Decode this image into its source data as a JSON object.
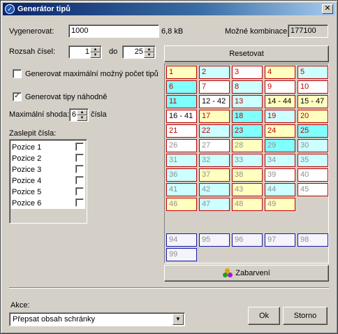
{
  "window": {
    "title": "Generátor tipů",
    "close_glyph": "✕"
  },
  "form": {
    "generate_label": "Vygenerovat:",
    "generate_value": "1000",
    "generate_size": "6,8 kB",
    "combinations_label": "Možné kombinace:",
    "combinations_value": "177100",
    "range_label": "Rozsah čísel:",
    "range_from": "1",
    "range_to_label": "do",
    "range_to": "25",
    "max_tips_label": "Generovat maximální možný počet tipů",
    "max_tips_checked": false,
    "random_label": "Generovat tipy náhodně",
    "random_checked": true,
    "max_match_label": "Maximální shoda:",
    "max_match_value": "6",
    "max_match_unit": "čísla",
    "hide_label": "Zaslepit čísla:",
    "positions": [
      {
        "label": "Pozice 1",
        "checked": false
      },
      {
        "label": "Pozice 2",
        "checked": false
      },
      {
        "label": "Pozice 3",
        "checked": false
      },
      {
        "label": "Pozice 4",
        "checked": false
      },
      {
        "label": "Pozice 5",
        "checked": false
      },
      {
        "label": "Pozice 6",
        "checked": false
      }
    ]
  },
  "grid": {
    "reset_label": "Resetovat",
    "color_label": "Zabarvení",
    "colors": {
      "white": "#ffffff",
      "yellow": "#ffffc0",
      "cyan": "#ccffff",
      "cyan_strong": "#80ffff",
      "red_border": "#c00000",
      "blue_border": "#1a1aa8"
    },
    "rows": [
      [
        {
          "t": "1",
          "c": "yellow"
        },
        {
          "t": "2",
          "c": "cyan"
        },
        {
          "t": "3",
          "c": "white"
        },
        {
          "t": "4",
          "c": "yellow"
        },
        {
          "t": "5",
          "c": "cyan"
        }
      ],
      [
        {
          "t": "6",
          "c": "cyan2"
        },
        {
          "t": "7",
          "c": "white"
        },
        {
          "t": "8",
          "c": "cyan"
        },
        {
          "t": "9",
          "c": "white"
        },
        {
          "t": "10",
          "c": "white"
        }
      ],
      [
        {
          "t": "11",
          "c": "cyan2"
        },
        {
          "t": "12 - 42",
          "c": "white"
        },
        {
          "t": "13",
          "c": "cyan"
        },
        {
          "t": "14 - 44",
          "c": "yellow"
        },
        {
          "t": "15 - 47",
          "c": "yellow"
        }
      ],
      [
        {
          "t": "16 - 41",
          "c": "white"
        },
        {
          "t": "17",
          "c": "yellow"
        },
        {
          "t": "18",
          "c": "cyan2"
        },
        {
          "t": "19",
          "c": "cyan"
        },
        {
          "t": "20",
          "c": "yellow"
        }
      ],
      [
        {
          "t": "21",
          "c": "white"
        },
        {
          "t": "22",
          "c": "cyan"
        },
        {
          "t": "23",
          "c": "cyan2"
        },
        {
          "t": "24",
          "c": "yellow"
        },
        {
          "t": "25",
          "c": "cyan2"
        }
      ],
      [
        {
          "t": "26",
          "c": "white"
        },
        {
          "t": "27",
          "c": "white"
        },
        {
          "t": "28",
          "c": "yellow"
        },
        {
          "t": "29",
          "c": "cyan2"
        },
        {
          "t": "30",
          "c": "cyan"
        }
      ],
      [
        {
          "t": "31",
          "c": "cyan"
        },
        {
          "t": "32",
          "c": "cyan"
        },
        {
          "t": "33",
          "c": "cyan"
        },
        {
          "t": "34",
          "c": "cyan"
        },
        {
          "t": "35",
          "c": "cyan"
        }
      ],
      [
        {
          "t": "36",
          "c": "cyan"
        },
        {
          "t": "37",
          "c": "yellow"
        },
        {
          "t": "38",
          "c": "yellow"
        },
        {
          "t": "39",
          "c": "white"
        },
        {
          "t": "40",
          "c": "white"
        }
      ],
      [
        {
          "t": "41",
          "c": "cyan"
        },
        {
          "t": "42",
          "c": "cyan"
        },
        {
          "t": "43",
          "c": "yellow"
        },
        {
          "t": "44",
          "c": "cyan"
        },
        {
          "t": "45",
          "c": "white"
        }
      ],
      [
        {
          "t": "46",
          "c": "yellow"
        },
        {
          "t": "47",
          "c": "cyan"
        },
        {
          "t": "48",
          "c": "yellow"
        },
        {
          "t": "49",
          "c": "yellow"
        }
      ]
    ],
    "blue_rows": [
      [
        "94",
        "95",
        "96",
        "97",
        "98"
      ],
      [
        "99"
      ]
    ]
  },
  "footer": {
    "action_label": "Akce:",
    "action_value": "Přepsat obsah schránky",
    "ok_label": "Ok",
    "cancel_label": "Storno"
  }
}
